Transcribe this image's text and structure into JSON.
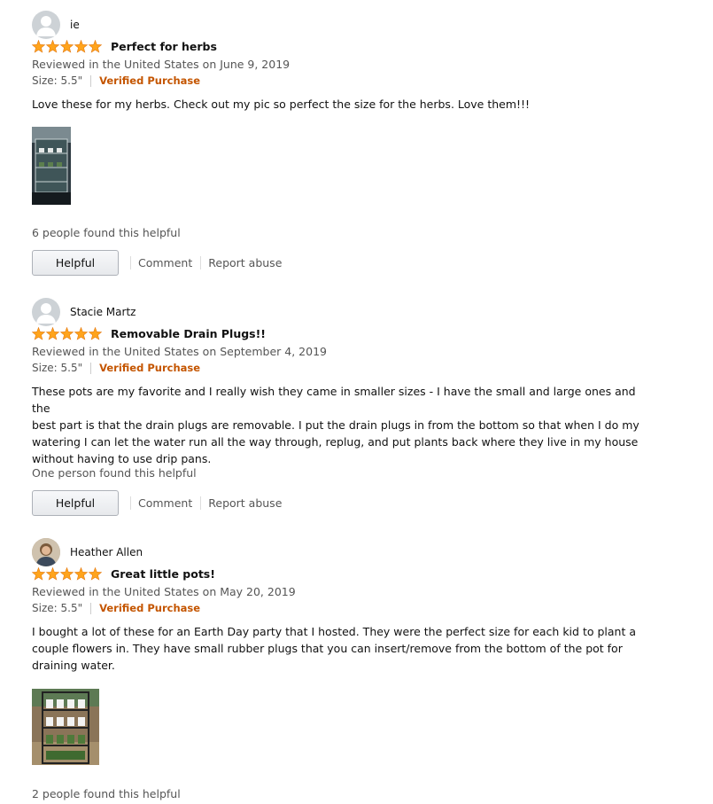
{
  "reviews": [
    {
      "name": "ie",
      "title": "Perfect for herbs",
      "rating": 5,
      "date": "Reviewed in the United States on June 9, 2019",
      "size": "Size: 5.5\"",
      "verified": "Verified Purchase",
      "body": [
        "Love these for my herbs. Check out my pic so perfect the size for the herbs. Love them!!!"
      ],
      "helpful_count": "6 people found this helpful",
      "helpful_label": "Helpful",
      "comment_label": "Comment",
      "report_label": "Report abuse"
    },
    {
      "name": "Stacie Martz",
      "title": "Removable Drain Plugs!!",
      "rating": 5,
      "date": "Reviewed in the United States on September 4, 2019",
      "size": "Size: 5.5\"",
      "verified": "Verified Purchase",
      "body": [
        "These pots are my favorite and I really wish they came in smaller sizes - I have the small and large ones and the",
        "best part is that the drain plugs are removable. I put the drain plugs in from the bottom so that when I do my",
        "watering I can let the water run all the way through, replug, and put plants back where they live in my house",
        "without having to use drip pans."
      ],
      "helpful_count": "One person found this helpful",
      "helpful_label": "Helpful",
      "comment_label": "Comment",
      "report_label": "Report abuse"
    },
    {
      "name": "Heather Allen",
      "title": "Great little pots!",
      "rating": 5,
      "date": "Reviewed in the United States on May 20, 2019",
      "size": "Size: 5.5\"",
      "verified": "Verified Purchase",
      "body": [
        "I bought a lot of these for an Earth Day party that I hosted. They were the perfect size for each kid to plant a",
        "couple flowers in. They have small rubber plugs that you can insert/remove from the bottom of the pot for",
        "draining water."
      ],
      "helpful_count": "2 people found this helpful"
    }
  ],
  "colors": {
    "star": "#ffa41c",
    "verified": "#c45500"
  }
}
